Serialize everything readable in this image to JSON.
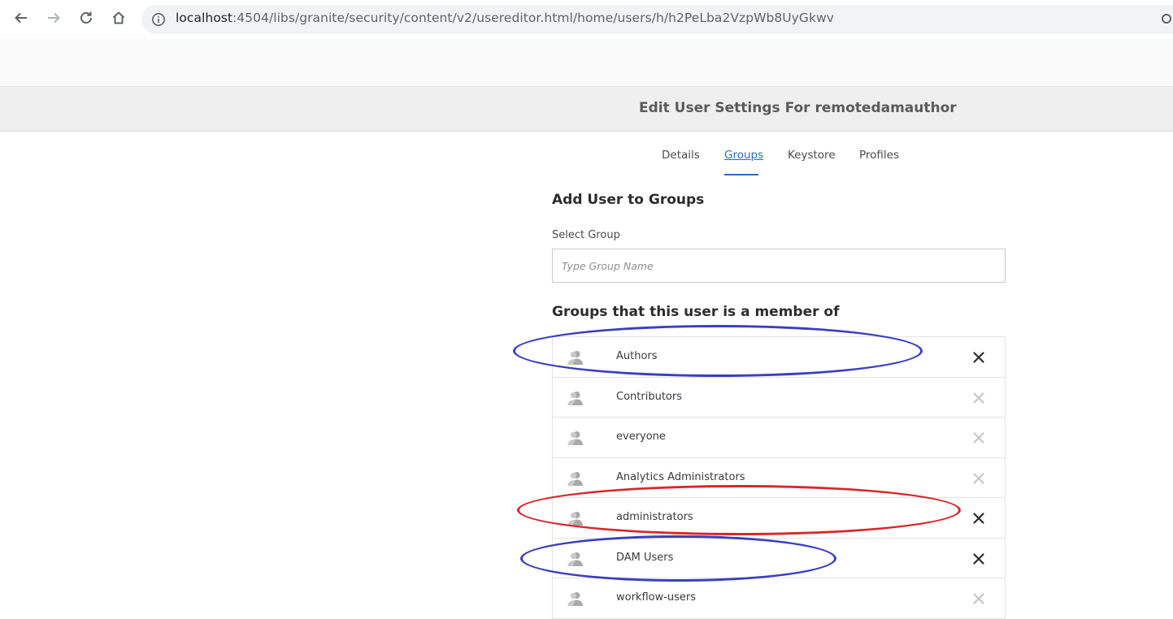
{
  "browser": {
    "url_host": "localhost",
    "url_rest": ":4504/libs/granite/security/content/v2/usereditor.html/home/users/h/h2PeLba2VzpWb8UyGkwv"
  },
  "header": {
    "title": "Edit User Settings For remotedamauthor"
  },
  "tabs": [
    {
      "label": "Details",
      "active": false
    },
    {
      "label": "Groups",
      "active": true
    },
    {
      "label": "Keystore",
      "active": false
    },
    {
      "label": "Profiles",
      "active": false
    }
  ],
  "add_section": {
    "heading": "Add User to Groups",
    "select_label": "Select Group",
    "placeholder": "Type Group Name"
  },
  "member_section": {
    "heading": "Groups that this user is a member of",
    "groups": [
      {
        "name": "Authors",
        "removable": true,
        "highlight": "blue"
      },
      {
        "name": "Contributors",
        "removable": false,
        "highlight": ""
      },
      {
        "name": "everyone",
        "removable": false,
        "highlight": ""
      },
      {
        "name": "Analytics Administrators",
        "removable": false,
        "highlight": ""
      },
      {
        "name": "administrators",
        "removable": true,
        "highlight": "red"
      },
      {
        "name": "DAM Users",
        "removable": true,
        "highlight": "blue"
      },
      {
        "name": "workflow-users",
        "removable": false,
        "highlight": ""
      }
    ]
  },
  "colors": {
    "accent": "#2b6bc3",
    "annotation_blue": "#3b3fbf",
    "annotation_red": "#d9262b",
    "remove_active": "#2c2c2c",
    "remove_inactive": "#c6c6c6"
  }
}
